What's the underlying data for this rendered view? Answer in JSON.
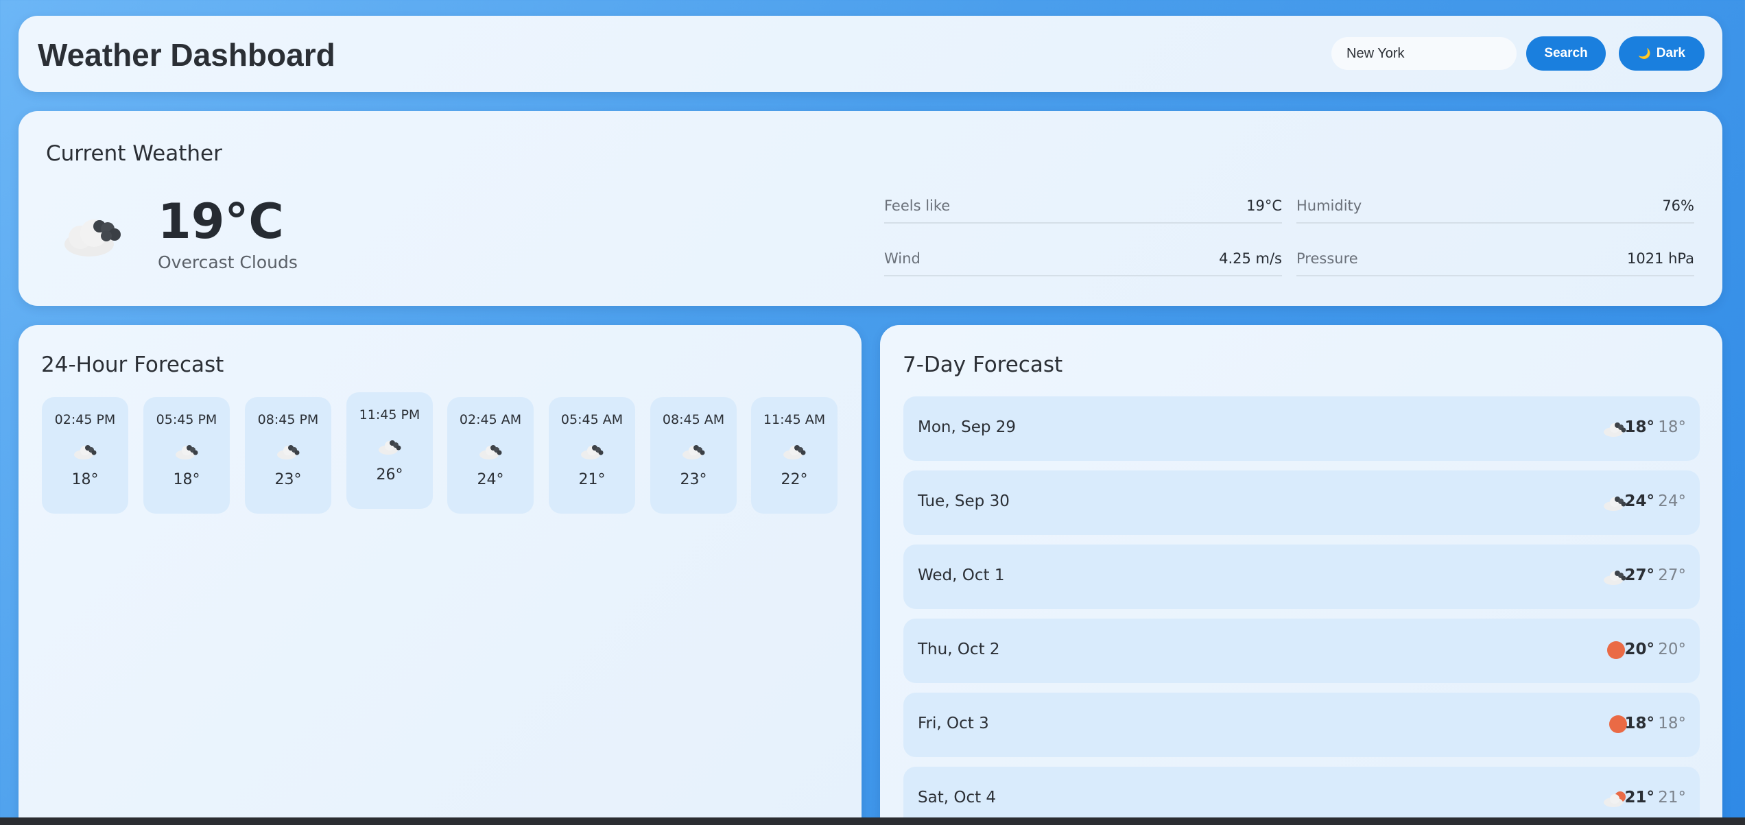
{
  "header": {
    "title": "Weather Dashboard",
    "search_value": "New York",
    "search_button": "Search",
    "dark_button": "Dark",
    "accent_color": "#1a7fde"
  },
  "current": {
    "section_title": "Current Weather",
    "icon": "overcast-clouds-icon",
    "temperature": "19°C",
    "condition": "Overcast Clouds",
    "details": {
      "feels_like_label": "Feels like",
      "feels_like_value": "19°C",
      "humidity_label": "Humidity",
      "humidity_value": "76%",
      "wind_label": "Wind",
      "wind_value": "4.25 m/s",
      "pressure_label": "Pressure",
      "pressure_value": "1021 hPa"
    }
  },
  "hourly": {
    "section_title": "24-Hour Forecast",
    "items": [
      {
        "time": "02:45 PM",
        "icon": "cloud-icon",
        "temp": "18°"
      },
      {
        "time": "05:45 PM",
        "icon": "cloud-icon",
        "temp": "18°"
      },
      {
        "time": "08:45 PM",
        "icon": "cloud-icon",
        "temp": "23°"
      },
      {
        "time": "11:45 PM",
        "icon": "cloud-icon",
        "temp": "26°"
      },
      {
        "time": "02:45 AM",
        "icon": "cloud-icon",
        "temp": "24°"
      },
      {
        "time": "05:45 AM",
        "icon": "cloud-icon",
        "temp": "21°"
      },
      {
        "time": "08:45 AM",
        "icon": "cloud-icon",
        "temp": "23°"
      },
      {
        "time": "11:45 AM",
        "icon": "cloud-icon",
        "temp": "22°"
      }
    ]
  },
  "daily": {
    "section_title": "7-Day Forecast",
    "items": [
      {
        "day": "Mon, Sep 29",
        "icon": "cloud-icon",
        "high": "18°",
        "low": "18°"
      },
      {
        "day": "Tue, Sep 30",
        "icon": "cloud-icon",
        "high": "24°",
        "low": "24°"
      },
      {
        "day": "Wed, Oct 1",
        "icon": "cloud-icon",
        "high": "27°",
        "low": "27°"
      },
      {
        "day": "Thu, Oct 2",
        "icon": "sun-icon",
        "high": "20°",
        "low": "20°"
      },
      {
        "day": "Fri, Oct 3",
        "icon": "sun-icon",
        "high": "18°",
        "low": "18°"
      },
      {
        "day": "Sat, Oct 4",
        "icon": "sun-cloud-icon",
        "high": "21°",
        "low": "21°"
      }
    ]
  }
}
